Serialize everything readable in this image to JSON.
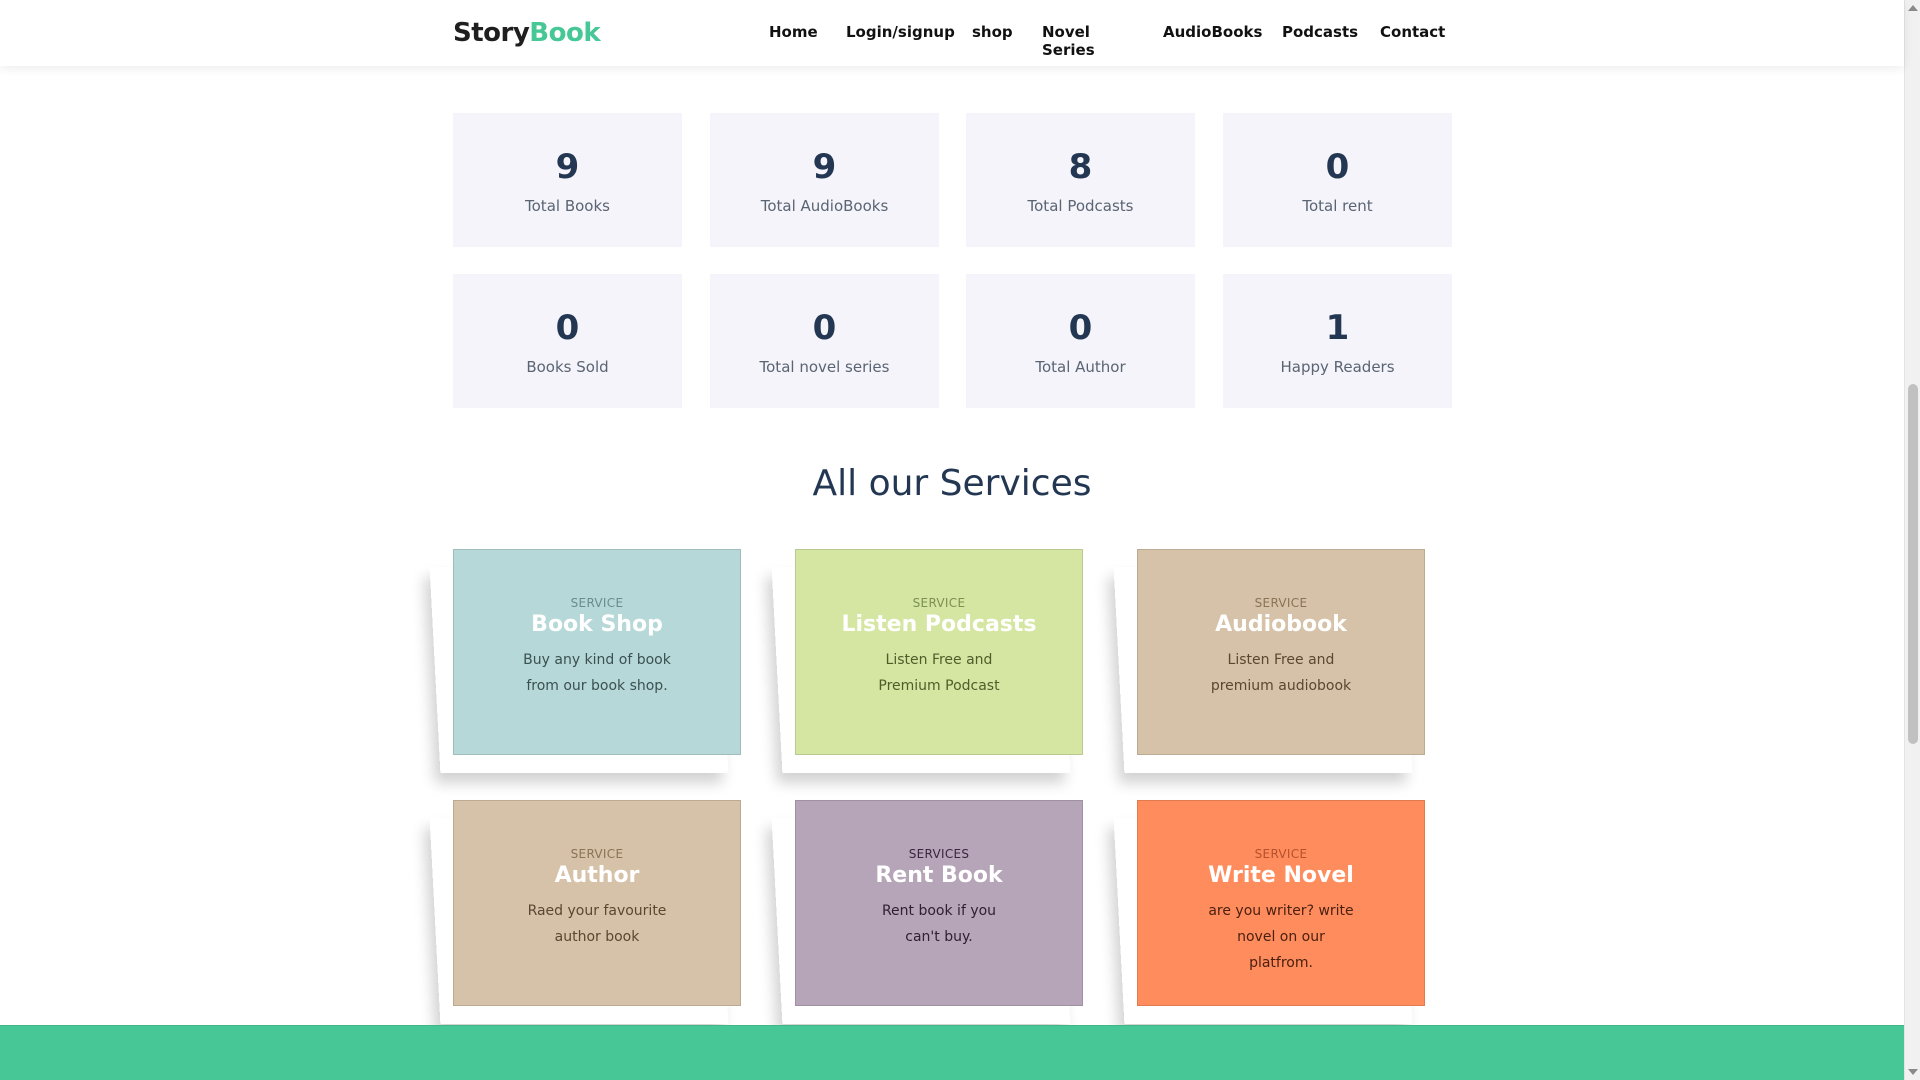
{
  "header": {
    "logo_part1": "Story",
    "logo_part2": "Book",
    "nav": [
      "Home",
      "Login/signup",
      "shop",
      "Novel Series",
      "AudioBooks",
      "Podcasts",
      "Contact"
    ]
  },
  "stats": [
    {
      "value": "9",
      "label": "Total Books"
    },
    {
      "value": "9",
      "label": "Total AudioBooks"
    },
    {
      "value": "8",
      "label": "Total Podcasts"
    },
    {
      "value": "0",
      "label": "Total rent"
    },
    {
      "value": "0",
      "label": "Books Sold"
    },
    {
      "value": "0",
      "label": "Total novel series"
    },
    {
      "value": "0",
      "label": "Total Author"
    },
    {
      "value": "1",
      "label": "Happy Readers"
    }
  ],
  "services": {
    "title": "All our Services",
    "cards": [
      {
        "kicker": "SERVICE",
        "title": "Book Shop",
        "desc": "Buy any kind of book from our book shop.",
        "bg": "#b7d8d8",
        "kicker_color": "#6a8c8c",
        "desc_color": "#3b5050"
      },
      {
        "kicker": "SERVICE",
        "title": "Listen Podcasts",
        "desc": "Listen Free and Premium Podcast",
        "bg": "#d4e6a2",
        "kicker_color": "#7d8f51",
        "desc_color": "#4e5d2a"
      },
      {
        "kicker": "SERVICE",
        "title": "Audiobook",
        "desc": "Listen Free and premium audiobook",
        "bg": "#d6c2a8",
        "kicker_color": "#8a7356",
        "desc_color": "#5a4632"
      },
      {
        "kicker": "SERVICE",
        "title": "Author",
        "desc": "Raed your favourite author book",
        "bg": "#d6c2a8",
        "kicker_color": "#8a7356",
        "desc_color": "#5a4632"
      },
      {
        "kicker": "SERVICES",
        "title": "Rent Book",
        "desc": "Rent book if you can't buy.",
        "bg": "#b6a5b8",
        "kicker_color": "#3c2340",
        "desc_color": "#2e2030"
      },
      {
        "kicker": "SERVICE",
        "title": "Write Novel",
        "desc": "are you writer? write novel on our platfrom.",
        "bg": "#ff8c5c",
        "kicker_color": "#b6512c",
        "desc_color": "#4a2010"
      }
    ]
  },
  "colors": {
    "brand_green": "#47c795",
    "stat_bg": "#f4f4fa",
    "heading": "#233753"
  }
}
